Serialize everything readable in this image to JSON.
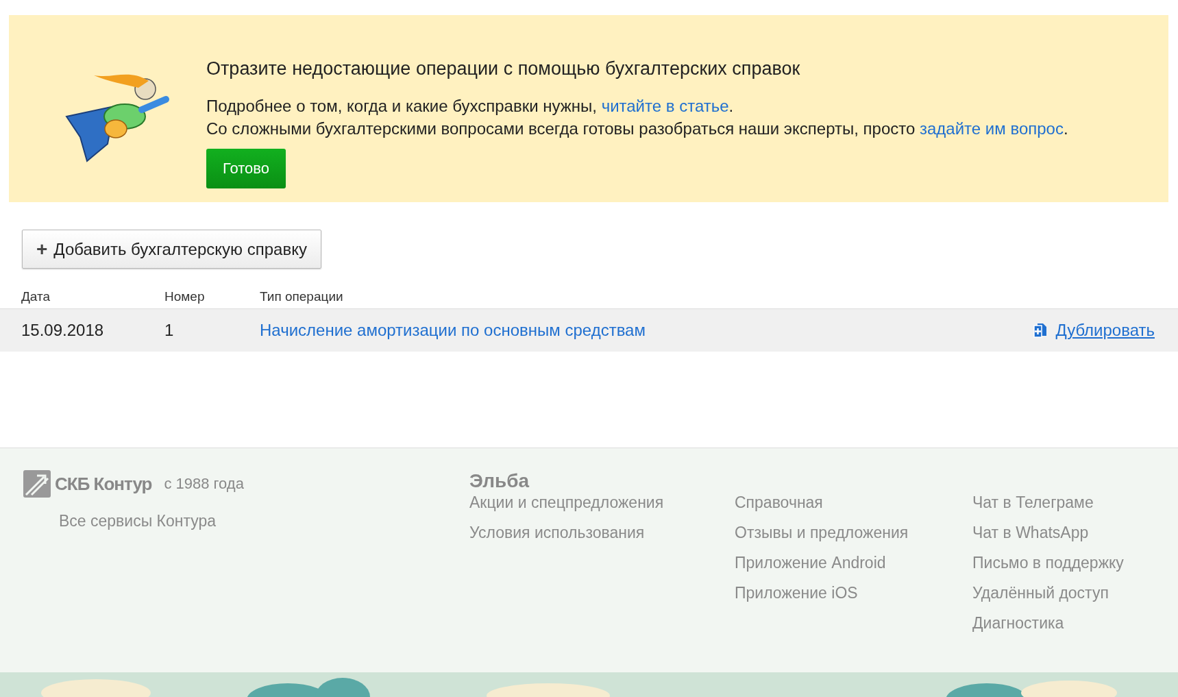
{
  "banner": {
    "title": "Отразите недостающие операции с помощью бухгалтерских справок",
    "lines": [
      {
        "text": "Подробнее о том, когда и какие бухсправки нужны, ",
        "link": "читайте в статье",
        "after": "."
      },
      {
        "text": "Со сложными бухгалтерскими вопросами всегда готовы разобраться наши эксперты, просто ",
        "link": "задайте им вопрос",
        "after": "."
      }
    ],
    "button": "Готово"
  },
  "add_button": {
    "icon": "+",
    "label": "Добавить бухгалтерскую справку"
  },
  "table": {
    "columns": [
      "Дата",
      "Номер",
      "Тип операции"
    ],
    "rows": [
      {
        "date": "15.09.2018",
        "number": "1",
        "operation": "Начисление амортизации по основным средствам",
        "action": "Дублировать",
        "hovered": true
      }
    ]
  },
  "footer": {
    "brand": "СКБ Контур",
    "since": "с 1988 года",
    "services_link": "Все сервисы Контура",
    "product": "Эльба",
    "columns": [
      [
        "Акции и спецпредложения",
        "Условия использования"
      ],
      [
        "Справочная",
        "Отзывы и предложения",
        "Приложение Android",
        "Приложение iOS"
      ],
      [
        "Чат в Телеграме",
        "Чат в WhatsApp",
        "Письмо в поддержку",
        "Удалённый доступ",
        "Диагностика"
      ]
    ]
  }
}
